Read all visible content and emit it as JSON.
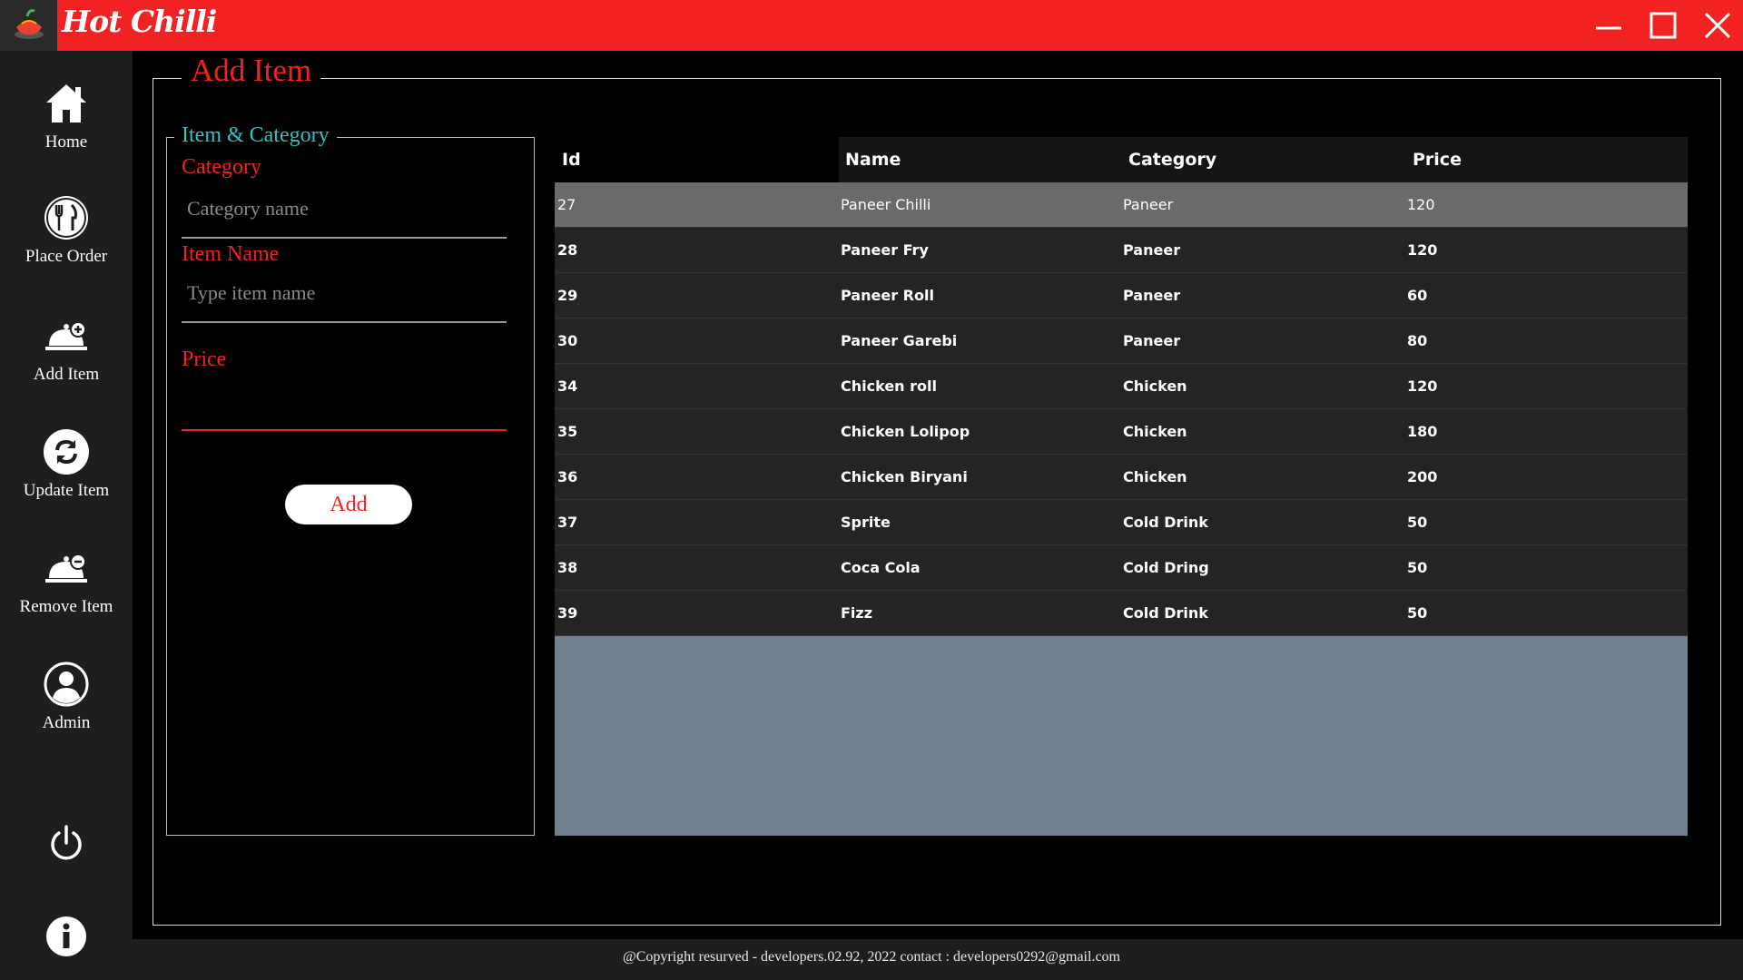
{
  "app": {
    "title": "Hot Chilli"
  },
  "sidebar": {
    "items": [
      {
        "label": "Home",
        "icon": "home-icon"
      },
      {
        "label": "Place Order",
        "icon": "cutlery-icon"
      },
      {
        "label": "Add Item",
        "icon": "dish-add-icon"
      },
      {
        "label": "Update Item",
        "icon": "refresh-icon"
      },
      {
        "label": "Remove Item",
        "icon": "dish-remove-icon"
      },
      {
        "label": "Admin",
        "icon": "user-icon"
      }
    ],
    "power_icon": "power-icon",
    "info_icon": "info-icon"
  },
  "page": {
    "title": "Add Item"
  },
  "form": {
    "group_title": "Item & Category",
    "category_label": "Category",
    "category_placeholder": "Category name",
    "category_value": "",
    "item_label": "Item Name",
    "item_placeholder": "Type item name",
    "item_value": "",
    "price_label": "Price",
    "price_value": "",
    "add_label": "Add"
  },
  "table": {
    "columns": [
      "Id",
      "Name",
      "Category",
      "Price"
    ],
    "rows": [
      {
        "id": "27",
        "name": "Paneer Chilli",
        "category": "Paneer",
        "price": "120",
        "selected": true
      },
      {
        "id": "28",
        "name": "Paneer Fry",
        "category": "Paneer",
        "price": "120"
      },
      {
        "id": "29",
        "name": "Paneer Roll",
        "category": "Paneer",
        "price": "60"
      },
      {
        "id": "30",
        "name": "Paneer Garebi",
        "category": "Paneer",
        "price": "80"
      },
      {
        "id": "34",
        "name": "Chicken roll",
        "category": "Chicken",
        "price": "120"
      },
      {
        "id": "35",
        "name": "Chicken Lolipop",
        "category": "Chicken",
        "price": "180"
      },
      {
        "id": "36",
        "name": "Chicken Biryani",
        "category": "Chicken",
        "price": "200"
      },
      {
        "id": "37",
        "name": "Sprite",
        "category": "Cold Drink",
        "price": "50"
      },
      {
        "id": "38",
        "name": "Coca Cola",
        "category": "Cold Dring",
        "price": "50"
      },
      {
        "id": "39",
        "name": "Fizz",
        "category": "Cold Drink",
        "price": "50"
      }
    ]
  },
  "footer": {
    "text": "@Copyright resurved - developers.02.92, 2022  contact : developers0292@gmail.com"
  },
  "colors": {
    "accent": "#f22222",
    "teal": "#2ec4c4",
    "grid_bg": "#708090",
    "row_bg": "#242424",
    "selected_row": "#6a6a6a"
  }
}
